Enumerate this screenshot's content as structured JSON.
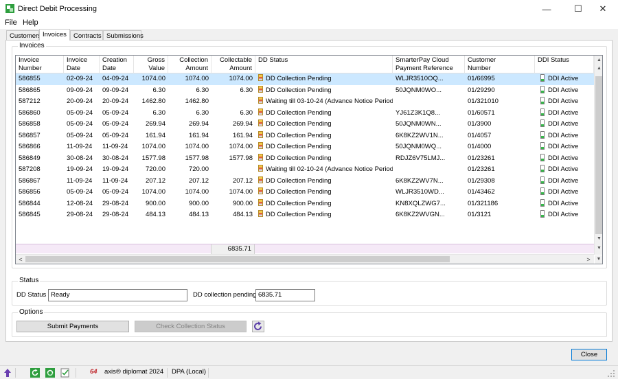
{
  "window": {
    "title": "Direct Debit Processing",
    "minimize_glyph": "—",
    "maximize_glyph": "☐",
    "close_glyph": "✕"
  },
  "menu": [
    "File",
    "Help"
  ],
  "tabs": [
    "Customers",
    "Invoices",
    "Contracts",
    "Submissions"
  ],
  "active_tab": "Invoices",
  "invoices_group": {
    "label": "Invoices",
    "columns": [
      "Invoice\nNumber",
      "Invoice\nDate",
      "Creation\nDate",
      "Gross\nValue",
      "Collection\nAmount",
      "Collectable\nAmount",
      "DD Status",
      "SmarterPay Cloud\nPayment Reference",
      "Customer\nNumber",
      "DDI Status"
    ],
    "rows": [
      {
        "invoice_number": "586855",
        "invoice_date": "02-09-24",
        "creation_date": "04-09-24",
        "gross": "1074.00",
        "collection": "1074.00",
        "collectable": "1074.00",
        "dd_status": "DD Collection Pending",
        "ref": "WLJR3510OQ...",
        "customer": "01/66995",
        "ddi_status": "DDI Active"
      },
      {
        "invoice_number": "586865",
        "invoice_date": "09-09-24",
        "creation_date": "09-09-24",
        "gross": "6.30",
        "collection": "6.30",
        "collectable": "6.30",
        "dd_status": "DD Collection Pending",
        "ref": "50JQNM0WO...",
        "customer": "01/29290",
        "ddi_status": "DDI Active"
      },
      {
        "invoice_number": "587212",
        "invoice_date": "20-09-24",
        "creation_date": "20-09-24",
        "gross": "1462.80",
        "collection": "1462.80",
        "collectable": "",
        "dd_status": "Waiting till 03-10-24 (Advance Notice Period)",
        "ref": "",
        "customer": "01/321010",
        "ddi_status": "DDI Active"
      },
      {
        "invoice_number": "586860",
        "invoice_date": "05-09-24",
        "creation_date": "05-09-24",
        "gross": "6.30",
        "collection": "6.30",
        "collectable": "6.30",
        "dd_status": "DD Collection Pending",
        "ref": "YJ61Z3K1Q8...",
        "customer": "01/60571",
        "ddi_status": "DDI Active"
      },
      {
        "invoice_number": "586858",
        "invoice_date": "05-09-24",
        "creation_date": "05-09-24",
        "gross": "269.94",
        "collection": "269.94",
        "collectable": "269.94",
        "dd_status": "DD Collection Pending",
        "ref": "50JQNM0WN...",
        "customer": "01/3900",
        "ddi_status": "DDI Active"
      },
      {
        "invoice_number": "586857",
        "invoice_date": "05-09-24",
        "creation_date": "05-09-24",
        "gross": "161.94",
        "collection": "161.94",
        "collectable": "161.94",
        "dd_status": "DD Collection Pending",
        "ref": "6K8KZ2WV1N...",
        "customer": "01/4057",
        "ddi_status": "DDI Active"
      },
      {
        "invoice_number": "586866",
        "invoice_date": "11-09-24",
        "creation_date": "11-09-24",
        "gross": "1074.00",
        "collection": "1074.00",
        "collectable": "1074.00",
        "dd_status": "DD Collection Pending",
        "ref": "50JQNM0WQ...",
        "customer": "01/4000",
        "ddi_status": "DDI Active"
      },
      {
        "invoice_number": "586849",
        "invoice_date": "30-08-24",
        "creation_date": "30-08-24",
        "gross": "1577.98",
        "collection": "1577.98",
        "collectable": "1577.98",
        "dd_status": "DD Collection Pending",
        "ref": "RDJZ6V75LMJ...",
        "customer": "01/23261",
        "ddi_status": "DDI Active"
      },
      {
        "invoice_number": "587208",
        "invoice_date": "19-09-24",
        "creation_date": "19-09-24",
        "gross": "720.00",
        "collection": "720.00",
        "collectable": "",
        "dd_status": "Waiting till 02-10-24 (Advance Notice Period)",
        "ref": "",
        "customer": "01/23261",
        "ddi_status": "DDI Active"
      },
      {
        "invoice_number": "586867",
        "invoice_date": "11-09-24",
        "creation_date": "11-09-24",
        "gross": "207.12",
        "collection": "207.12",
        "collectable": "207.12",
        "dd_status": "DD Collection Pending",
        "ref": "6K8KZ2WV7N...",
        "customer": "01/29308",
        "ddi_status": "DDI Active"
      },
      {
        "invoice_number": "586856",
        "invoice_date": "05-09-24",
        "creation_date": "05-09-24",
        "gross": "1074.00",
        "collection": "1074.00",
        "collectable": "1074.00",
        "dd_status": "DD Collection Pending",
        "ref": "WLJR3510WD...",
        "customer": "01/43462",
        "ddi_status": "DDI Active"
      },
      {
        "invoice_number": "586844",
        "invoice_date": "12-08-24",
        "creation_date": "29-08-24",
        "gross": "900.00",
        "collection": "900.00",
        "collectable": "900.00",
        "dd_status": "DD Collection Pending",
        "ref": "KN8XQLZWG7...",
        "customer": "01/321186",
        "ddi_status": "DDI Active"
      },
      {
        "invoice_number": "586845",
        "invoice_date": "29-08-24",
        "creation_date": "29-08-24",
        "gross": "484.13",
        "collection": "484.13",
        "collectable": "484.13",
        "dd_status": "DD Collection Pending",
        "ref": "6K8KZ2WVGN...",
        "customer": "01/3121",
        "ddi_status": "DDI Active"
      }
    ],
    "selected_row": 0,
    "total_collectable": "6835.71"
  },
  "status_group": {
    "label": "Status",
    "dd_status_label": "DD Status",
    "dd_status_value": "Ready",
    "pending_label": "DD collection pending",
    "pending_value": "6835.71"
  },
  "options_group": {
    "label": "Options",
    "submit_label": "Submit Payments",
    "check_label": "Check Collection Status"
  },
  "close_label": "Close",
  "statusbar": {
    "app_number": "64",
    "app_name": "axis® diplomat 2024",
    "database": "DPA (Local)"
  },
  "colors": {
    "selection": "#cce8ff",
    "totals_row": "#f5e9f7",
    "accent_border": "#0078d7"
  }
}
